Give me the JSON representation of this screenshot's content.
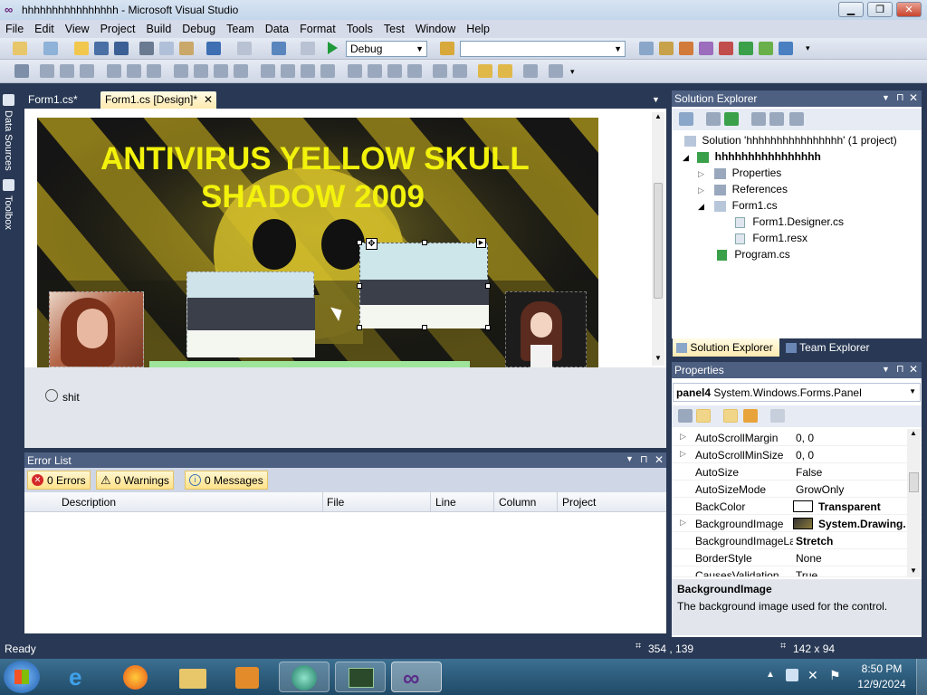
{
  "window": {
    "title": "hhhhhhhhhhhhhhhh - Microsoft Visual Studio",
    "minimize_icon": "minimize-icon",
    "maximize_icon": "maximize-icon",
    "close_icon": "close-icon"
  },
  "menu": [
    "File",
    "Edit",
    "View",
    "Project",
    "Build",
    "Debug",
    "Team",
    "Data",
    "Format",
    "Tools",
    "Test",
    "Window",
    "Help"
  ],
  "toolbar": {
    "config_value": "Debug",
    "platform_value": ""
  },
  "left_strip": {
    "data_sources": "Data Sources",
    "toolbox": "Toolbox"
  },
  "doc_tabs": [
    {
      "label": "Form1.cs*",
      "active": false
    },
    {
      "label": "Form1.cs [Design]*",
      "active": true
    }
  ],
  "form": {
    "heading_line1": "ANTIVIRUS YELLOW SKULL",
    "heading_line2": "SHADOW 2009",
    "component_tray_item": "shit"
  },
  "error_list": {
    "title": "Error List",
    "errors": "0 Errors",
    "warnings": "0 Warnings",
    "messages": "0 Messages",
    "columns": [
      "Description",
      "File",
      "Line",
      "Column",
      "Project"
    ]
  },
  "solution_explorer": {
    "title": "Solution Explorer",
    "solution": "Solution 'hhhhhhhhhhhhhhhh' (1 project)",
    "project": "hhhhhhhhhhhhhhhh",
    "items": [
      "Properties",
      "References",
      "Form1.cs",
      "Form1.Designer.cs",
      "Form1.resx",
      "Program.cs"
    ],
    "tab1": "Solution Explorer",
    "tab2": "Team Explorer"
  },
  "properties": {
    "title": "Properties",
    "object_name": "panel4",
    "object_type": "System.Windows.Forms.Panel",
    "rows": [
      {
        "name": "AutoScrollMargin",
        "value": "0, 0"
      },
      {
        "name": "AutoScrollMinSize",
        "value": "0, 0"
      },
      {
        "name": "AutoSize",
        "value": "False"
      },
      {
        "name": "AutoSizeMode",
        "value": "GrowOnly"
      },
      {
        "name": "BackColor",
        "value": "Transparent"
      },
      {
        "name": "BackgroundImage",
        "value": "System.Drawing."
      },
      {
        "name": "BackgroundImageLa",
        "value": "Stretch"
      },
      {
        "name": "BorderStyle",
        "value": "None"
      },
      {
        "name": "CausesValidation",
        "value": "True"
      }
    ],
    "desc_title": "BackgroundImage",
    "desc_text": "The background image used for the control."
  },
  "status": {
    "text": "Ready",
    "position": "354 , 139",
    "size": "142 x 94"
  },
  "clock": {
    "time": "8:50 PM",
    "date": "12/9/2024"
  }
}
